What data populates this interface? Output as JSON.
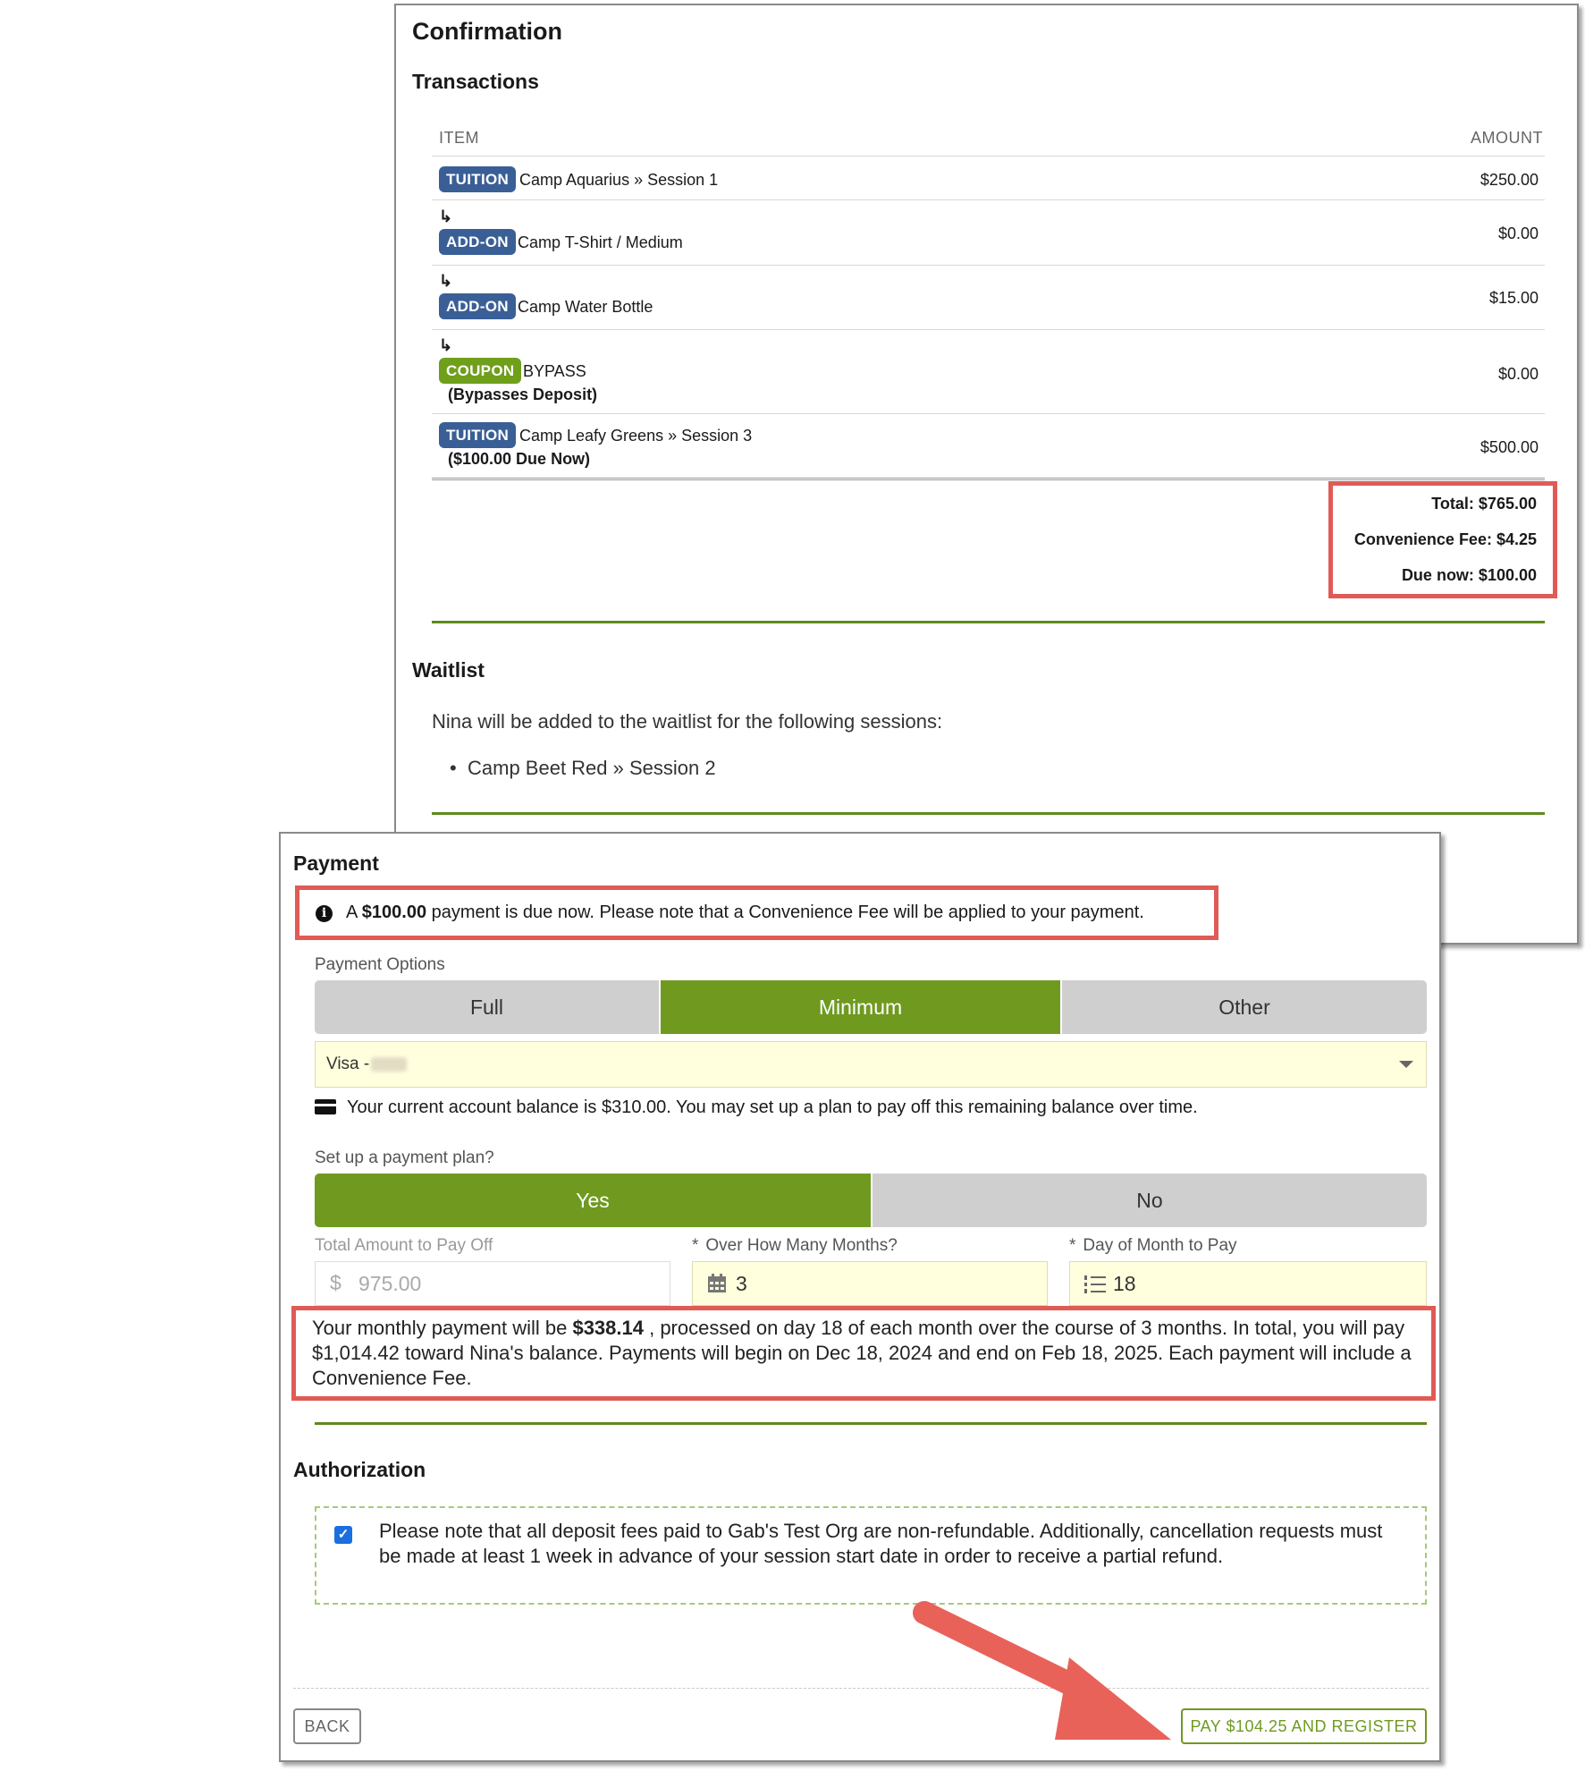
{
  "confirmation": {
    "title": "Confirmation",
    "transactions_heading": "Transactions",
    "col_item": "ITEM",
    "col_amount": "AMOUNT",
    "rows": [
      {
        "badge": "TUITION",
        "text": "Camp Aquarius » Session 1",
        "note": "",
        "amount": "$250.00"
      },
      {
        "badge": "ADD-ON",
        "text": "Camp T-Shirt / Medium",
        "note": "",
        "amount": "$0.00"
      },
      {
        "badge": "ADD-ON",
        "text": "Camp Water Bottle",
        "note": "",
        "amount": "$15.00"
      },
      {
        "badge": "COUPON",
        "text": "BYPASS",
        "note": "(Bypasses Deposit)",
        "amount": "$0.00"
      },
      {
        "badge": "TUITION",
        "text": "Camp Leafy Greens » Session 3",
        "note": "($100.00 Due Now)",
        "amount": "$500.00"
      }
    ],
    "sub_arrow": "↳",
    "totals": {
      "total": "Total: $765.00",
      "fee": "Convenience Fee: $4.25",
      "due": "Due now: $100.00"
    },
    "waitlist_heading": "Waitlist",
    "waitlist_text": "Nina will be added to the waitlist for the following sessions:",
    "waitlist_items": [
      "Camp Beet Red » Session 2"
    ]
  },
  "payment": {
    "heading": "Payment",
    "due_prefix": "A ",
    "due_amount": "$100.00",
    "due_suffix": " payment is due now. Please note that a Convenience Fee will be applied to your payment.",
    "options_label": "Payment Options",
    "options": [
      "Full",
      "Minimum",
      "Other"
    ],
    "selected_option": "Minimum",
    "card_value": "Visa -",
    "balance_text": "Your current account balance is $310.00. You may set up a plan to pay off this remaining balance over time.",
    "plan_label": "Set up a payment plan?",
    "plan_options": [
      "Yes",
      "No"
    ],
    "plan_selected": "Yes",
    "total_label": "Total Amount to Pay Off",
    "total_prefix": "$",
    "total_value": "975.00",
    "months_label": "Over How Many Months?",
    "months_value": "3",
    "day_label": "Day of Month to Pay",
    "day_value": "18",
    "required_mark": "*",
    "plan_summary_pre": "Your monthly payment will be ",
    "plan_summary_amount": "$338.14",
    "plan_summary_post": " , processed on day 18 of each month over the course of 3 months. In total, you will pay $1,014.42 toward Nina's balance. Payments will begin on Dec 18, 2024 and end on Feb 18, 2025. Each payment will include a Convenience Fee.",
    "auth_heading": "Authorization",
    "auth_text": "Please note that all deposit fees paid to Gab's Test Org are non-refundable. Additionally, cancellation requests must be made at least 1 week in advance of your session start date in order to receive a partial refund.",
    "auth_checked": true,
    "back_label": "BACK",
    "pay_label": "PAY $104.25 AND REGISTER"
  },
  "colors": {
    "accent_green": "#6f9a1f",
    "badge_blue": "#3a5f96",
    "badge_green": "#6f9f1b",
    "highlight_red": "#e05a56",
    "input_yellow": "#ffffde"
  },
  "icons": [
    "info-icon",
    "credit-card-icon",
    "calendar-icon",
    "list-ordered-icon",
    "checkbox-checked-icon",
    "dropdown-caret-icon",
    "return-arrow-icon",
    "annotation-arrow"
  ]
}
